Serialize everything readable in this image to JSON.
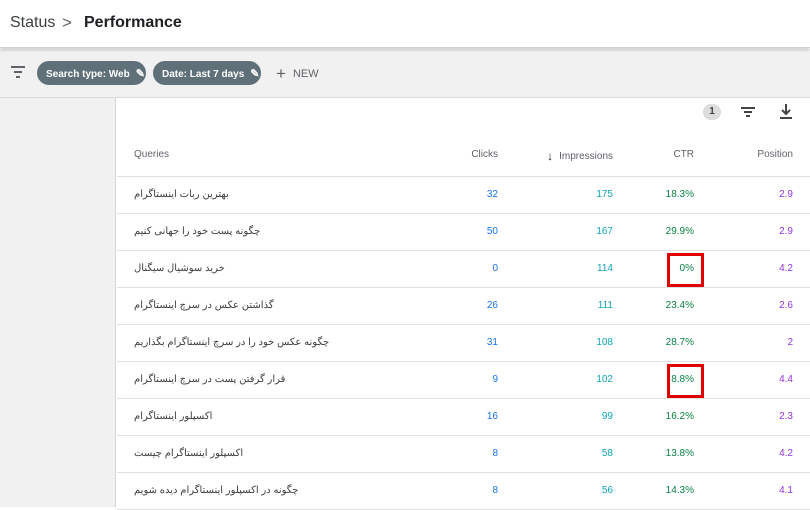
{
  "breadcrumb": {
    "parent": "Status",
    "separator": ">",
    "current": "Performance"
  },
  "filters": {
    "search_type": "Search type: Web",
    "date": "Date: Last 7 days",
    "new_label": "NEW",
    "new_plus": "+"
  },
  "toolbar": {
    "filter_count": "1"
  },
  "table": {
    "headers": {
      "queries": "Queries",
      "clicks": "Clicks",
      "impressions": "Impressions",
      "ctr": "CTR",
      "position": "Position"
    },
    "rows": [
      {
        "query": "بهترین ربات اینستاگرام",
        "clicks": "32",
        "impressions": "175",
        "ctr": "18.3%",
        "position": "2.9",
        "highlighted": false
      },
      {
        "query": "چگونه پست خود را جهانی کنیم",
        "clicks": "50",
        "impressions": "167",
        "ctr": "29.9%",
        "position": "2.9",
        "highlighted": false
      },
      {
        "query": "خرید سوشیال سیگنال",
        "clicks": "0",
        "impressions": "114",
        "ctr": "0%",
        "position": "4.2",
        "highlighted": true
      },
      {
        "query": "گذاشتن عکس در سرچ اینستاگرام",
        "clicks": "26",
        "impressions": "111",
        "ctr": "23.4%",
        "position": "2.6",
        "highlighted": false
      },
      {
        "query": "چگونه عکس خود را در سرچ اینستاگرام بگذاریم",
        "clicks": "31",
        "impressions": "108",
        "ctr": "28.7%",
        "position": "2",
        "highlighted": false
      },
      {
        "query": "قرار گرفتن پست در سرچ اینستاگرام",
        "clicks": "9",
        "impressions": "102",
        "ctr": "8.8%",
        "position": "4.4",
        "highlighted": true
      },
      {
        "query": "اکسپلور اینستاگرام",
        "clicks": "16",
        "impressions": "99",
        "ctr": "16.2%",
        "position": "2.3",
        "highlighted": false
      },
      {
        "query": "اکسپلور اینستاگرام چیست",
        "clicks": "8",
        "impressions": "58",
        "ctr": "13.8%",
        "position": "4.2",
        "highlighted": false
      },
      {
        "query": "چگونه در اکسپلور اینستاگرام دیده شویم",
        "clicks": "8",
        "impressions": "56",
        "ctr": "14.3%",
        "position": "4.1",
        "highlighted": false
      }
    ]
  },
  "colors": {
    "clicks": "#1a73e8",
    "impressions": "#12a4b5",
    "ctr": "#0b8043",
    "position": "#9334e6",
    "highlight_box": "#e00000",
    "chip": "#5f7078"
  }
}
